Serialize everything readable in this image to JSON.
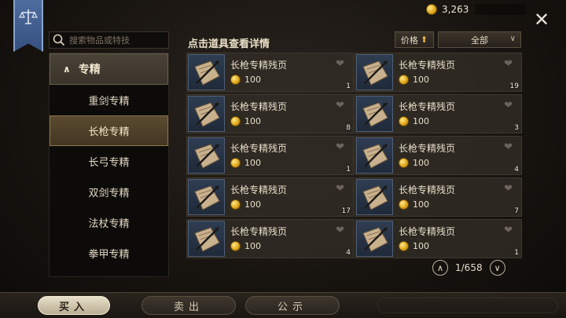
{
  "currency": {
    "gold_amount": "3,263"
  },
  "search": {
    "placeholder": "搜索物品或特技"
  },
  "category": {
    "header_label": "专精",
    "items": [
      {
        "label": "重剑专精"
      },
      {
        "label": "长枪专精"
      },
      {
        "label": "长弓专精"
      },
      {
        "label": "双剑专精"
      },
      {
        "label": "法杖专精"
      },
      {
        "label": "拳甲专精"
      }
    ],
    "selected": "长枪专精"
  },
  "listing": {
    "hint": "点击道具查看详情",
    "sort_label": "价格",
    "filter_label": "全部",
    "items": [
      {
        "name": "长枪专精残页",
        "price": "100",
        "qty": "1"
      },
      {
        "name": "长枪专精残页",
        "price": "100",
        "qty": "19"
      },
      {
        "name": "长枪专精残页",
        "price": "100",
        "qty": "8"
      },
      {
        "name": "长枪专精残页",
        "price": "100",
        "qty": "3"
      },
      {
        "name": "长枪专精残页",
        "price": "100",
        "qty": "1"
      },
      {
        "name": "长枪专精残页",
        "price": "100",
        "qty": "4"
      },
      {
        "name": "长枪专精残页",
        "price": "100",
        "qty": "17"
      },
      {
        "name": "长枪专精残页",
        "price": "100",
        "qty": "7"
      },
      {
        "name": "长枪专精残页",
        "price": "100",
        "qty": "4"
      },
      {
        "name": "长枪专精残页",
        "price": "100",
        "qty": "1"
      }
    ]
  },
  "pagination": {
    "text": "1/658"
  },
  "footer_tabs": [
    {
      "label": "买入",
      "active": true
    },
    {
      "label": "卖出",
      "active": false
    },
    {
      "label": "公示",
      "active": false
    }
  ],
  "colors": {
    "banner": "#3f5c8c",
    "accent_gold": "#e0a81a",
    "selected_tab": "#5a4a30"
  }
}
